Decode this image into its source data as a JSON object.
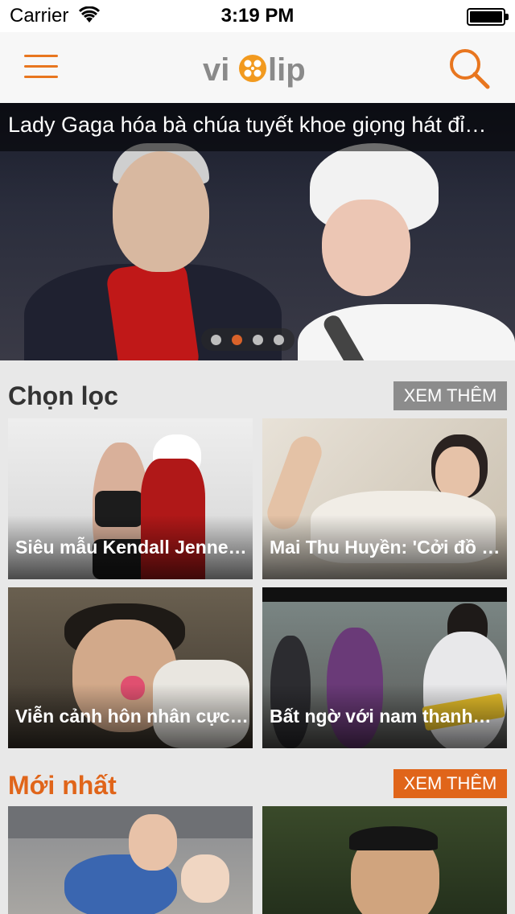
{
  "status": {
    "carrier": "Carrier",
    "time": "3:19 PM"
  },
  "app": {
    "logo_text": "viclip",
    "brand_color": "#e8761f"
  },
  "icons": {
    "menu": "hamburger-menu-icon",
    "search": "search-icon",
    "wifi": "wifi-icon",
    "battery": "battery-icon"
  },
  "hero": {
    "caption": "Lady Gaga hóa bà chúa tuyết khoe giọng hát đỉ…",
    "slides": 4,
    "active_slide": 2
  },
  "sections": {
    "featured": {
      "title": "Chọn lọc",
      "more_label": "XEM THÊM",
      "items": [
        {
          "title": "Siêu mẫu Kendall Jenne…"
        },
        {
          "title": "Mai Thu Huyền: 'Cởi đồ l…"
        },
        {
          "title": "Viễn cảnh hôn nhân cực…"
        },
        {
          "title": "Bất ngờ với nam thanh…"
        }
      ]
    },
    "latest": {
      "title": "Mới nhất",
      "more_label": "XEM THÊM",
      "items": [
        {
          "title": ""
        },
        {
          "title": ""
        }
      ]
    }
  },
  "colors": {
    "featured_title": "#333333",
    "featured_more_bg": "#8c8c8c",
    "latest_title": "#e0651a",
    "latest_more_bg": "#e0651a",
    "dot_active": "#d9622a"
  }
}
